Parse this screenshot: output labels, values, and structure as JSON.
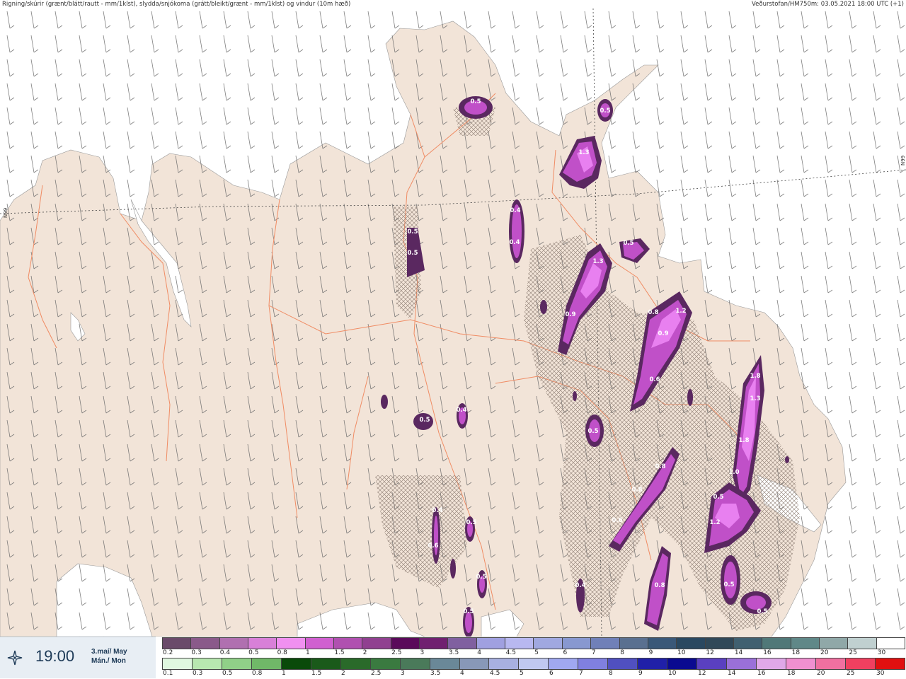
{
  "header": {
    "title": "Rigning/skúrir (grænt/blátt/rautt - mm/1klst), slydda/snjókoma (grátt/bleikt/grænt - mm/1klst) og vindur (10m hæð)",
    "source": "Veðurstofan/HM750m: 03.05.2021 18:00 UTC (+1)"
  },
  "map": {
    "grid_labels": [
      "N99",
      "N99"
    ],
    "precip_labels": [
      "0.5",
      "0.5",
      "1.3",
      "0.4",
      "0.4",
      "0.5",
      "0.5",
      "1.3",
      "0.9",
      "0.5",
      "0.8",
      "1.2",
      "0.9",
      "0.6",
      "1.8",
      "1.3",
      "1.8",
      "0.5",
      "0.5",
      "0.4",
      "0.8",
      "0.8",
      "0.6",
      "1.0",
      "0.5",
      "1.2",
      "0.4",
      "0.5",
      "0.6",
      "0.5",
      "0.4",
      "0.8",
      "0.5",
      "0.5",
      "0.5"
    ],
    "colors": {
      "sea": "#ffffff",
      "land": "#f2e4d8",
      "roads": "#f08c64",
      "precip_light": "#c050c8",
      "precip_core": "#e880f0",
      "precip_dark": "#5a2860"
    }
  },
  "footer": {
    "time": "19:00",
    "date_line1": "3.maí/ May",
    "date_line2": "Mán./ Mon",
    "icon": "wind-rose-icon"
  },
  "colorbar_rain": {
    "labels": [
      "0.2",
      "0.3",
      "0.4",
      "0.5",
      "0.8",
      "1",
      "1.5",
      "2",
      "2.5",
      "3",
      "3.5",
      "4",
      "4.5",
      "5",
      "6",
      "7",
      "8",
      "9",
      "10",
      "12",
      "14",
      "16",
      "18",
      "20",
      "25",
      "30"
    ],
    "colors": [
      "#6a4a6a",
      "#8a5a8a",
      "#b070b0",
      "#d880d8",
      "#f090f0",
      "#d060d0",
      "#b050b0",
      "#904090",
      "#5a0a5a",
      "#702070",
      "#8060a0",
      "#a0a0e0",
      "#b8b8f0",
      "#a0a8e0",
      "#8898d0",
      "#7080b8",
      "#5a7090",
      "#3a5878",
      "#2a4860",
      "#304858",
      "#406070",
      "#507878",
      "#608888",
      "#90a8a8",
      "#c0d0d0",
      "#ffffff"
    ]
  },
  "colorbar_snow": {
    "labels": [
      "0.1",
      "0.3",
      "0.5",
      "0.8",
      "1",
      "1.5",
      "2",
      "2.5",
      "3",
      "3.5",
      "4",
      "4.5",
      "5",
      "6",
      "7",
      "8",
      "9",
      "10",
      "12",
      "14",
      "16",
      "18",
      "20",
      "25",
      "30"
    ],
    "colors": [
      "#e0f8e0",
      "#b8e8b0",
      "#90d088",
      "#70b868",
      "#0a4a0a",
      "#1a5a1a",
      "#2a6a2a",
      "#3a7a40",
      "#4a7a5a",
      "#6a8898",
      "#8898b8",
      "#a8b0e0",
      "#c0c8f0",
      "#a0a8f0",
      "#8080e0",
      "#5050c0",
      "#2020a8",
      "#0a0a90",
      "#5a40c0",
      "#9a70d8",
      "#e0a8e8",
      "#f090d0",
      "#f070a0",
      "#f04060",
      "#e01010"
    ]
  }
}
